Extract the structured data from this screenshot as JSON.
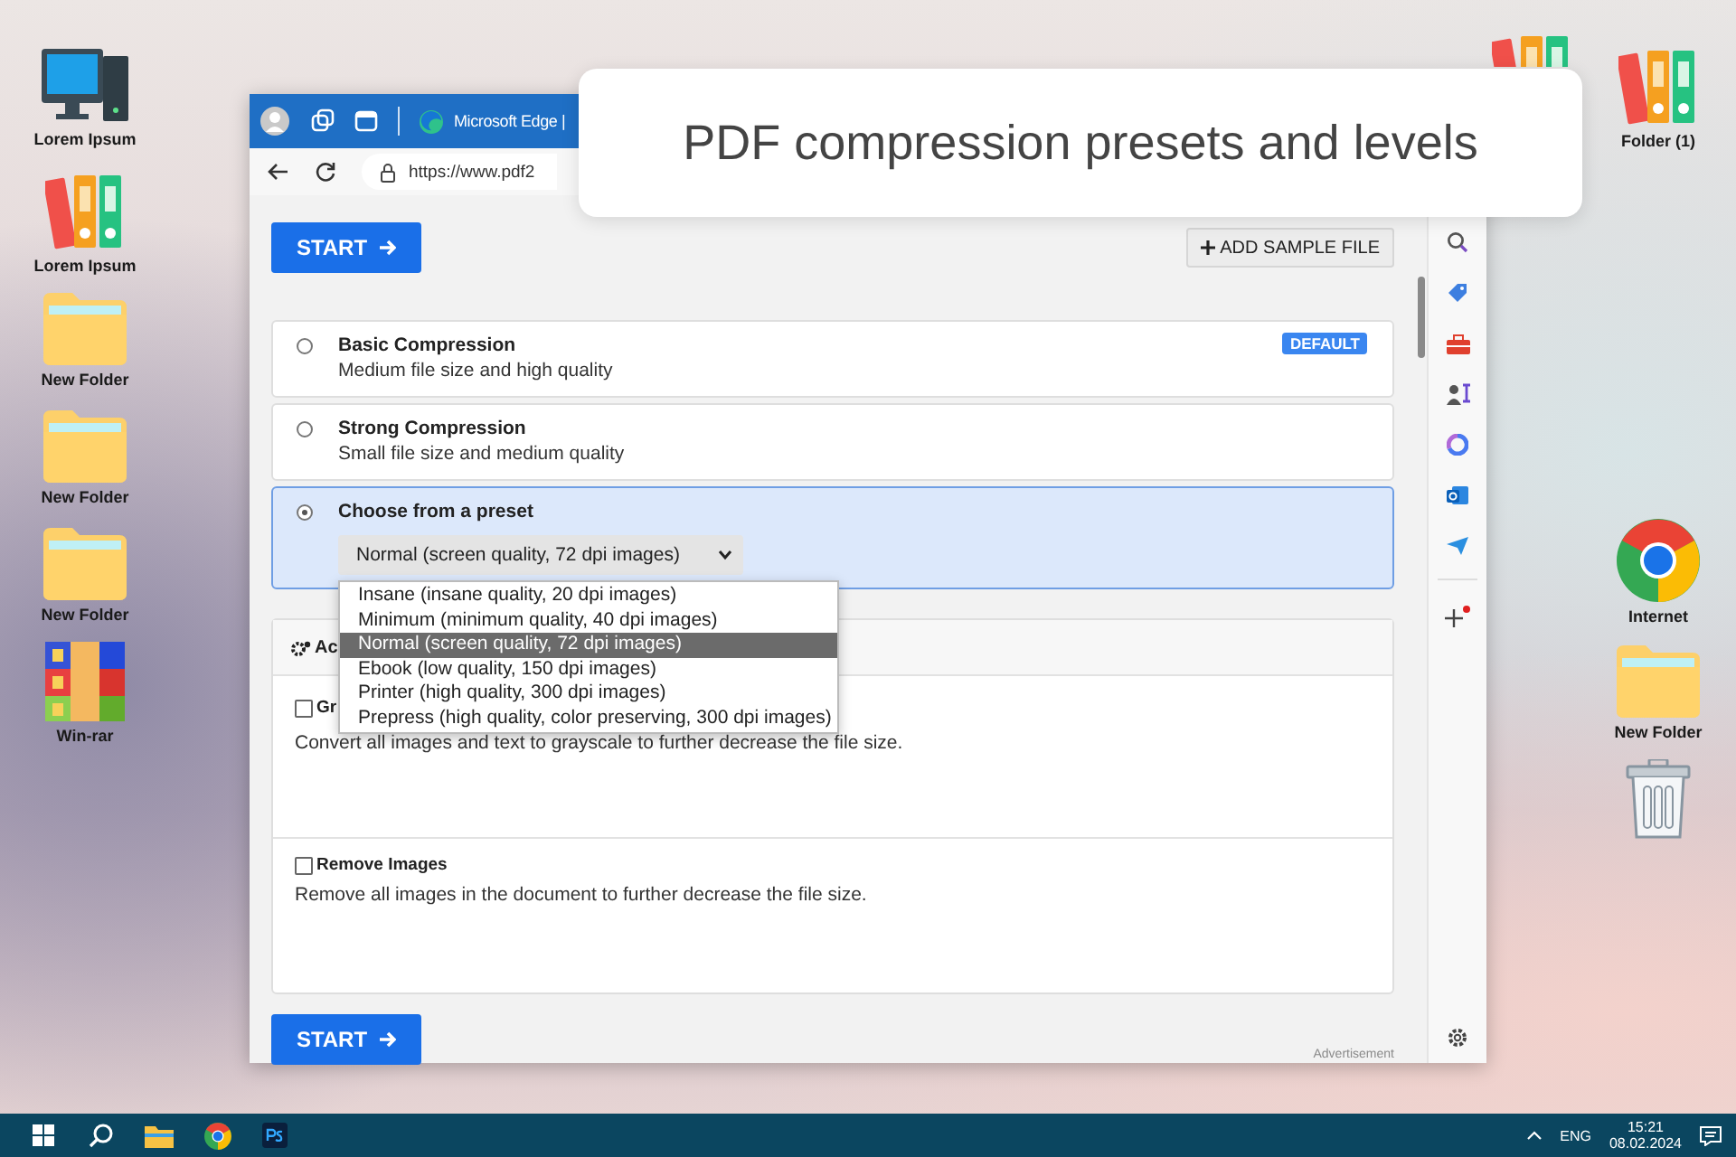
{
  "desktop_left": [
    {
      "kind": "monitor",
      "label": "Lorem Ipsum"
    },
    {
      "kind": "binders",
      "label": "Lorem Ipsum"
    },
    {
      "kind": "folder",
      "label": "New Folder"
    },
    {
      "kind": "folder",
      "label": "New Folder"
    },
    {
      "kind": "folder",
      "label": "New Folder"
    },
    {
      "kind": "archive",
      "label": "Win-rar"
    }
  ],
  "desktop_right": [
    {
      "kind": "binders",
      "label": "Folder (1)"
    },
    {
      "kind": "chrome",
      "label": "Internet"
    },
    {
      "kind": "folder",
      "label": "New Folder"
    },
    {
      "kind": "trash"
    }
  ],
  "caption": "PDF compression presets and levels",
  "browser": {
    "tab_title": "Microsoft Edge |",
    "url": "https://www.pdf2"
  },
  "page": {
    "start_button": "START",
    "add_sample_button": "ADD SAMPLE FILE",
    "options": [
      {
        "kind": "simple",
        "title": "Basic Compression",
        "subtitle": "Medium file size and high quality",
        "badge": "DEFAULT",
        "selected": false
      },
      {
        "kind": "simple",
        "title": "Strong Compression",
        "subtitle": "Small file size and medium quality",
        "selected": false
      },
      {
        "kind": "preset",
        "title": "Choose from a preset",
        "selected": true
      }
    ],
    "preset_select": {
      "value": "Normal (screen quality, 72 dpi images)",
      "expanded": true,
      "options": [
        {
          "label": "Insane (insane quality, 20 dpi images)",
          "selected": false
        },
        {
          "label": "Minimum (minimum quality, 40 dpi images)",
          "selected": false
        },
        {
          "label": "Normal (screen quality, 72 dpi images)",
          "selected": true
        },
        {
          "label": "Ebook (low quality, 150 dpi images)",
          "selected": false
        },
        {
          "label": "Printer (high quality, 300 dpi images)",
          "selected": false
        },
        {
          "label": "Prepress (high quality, color preserving, 300 dpi images)",
          "selected": false
        }
      ]
    },
    "advanced": {
      "header": "Ac",
      "items": [
        {
          "label": "Gr",
          "checked": false,
          "description": "Convert all images and text to grayscale to further decrease the file size."
        },
        {
          "label": "Remove Images",
          "checked": false,
          "description": "Remove all images in the document to further decrease the file size."
        }
      ]
    },
    "bottom_start_button": "START",
    "ad_label": "Advertisement"
  },
  "taskbar": {
    "language": "ENG",
    "time": "15:21",
    "date": "08.02.2024"
  }
}
